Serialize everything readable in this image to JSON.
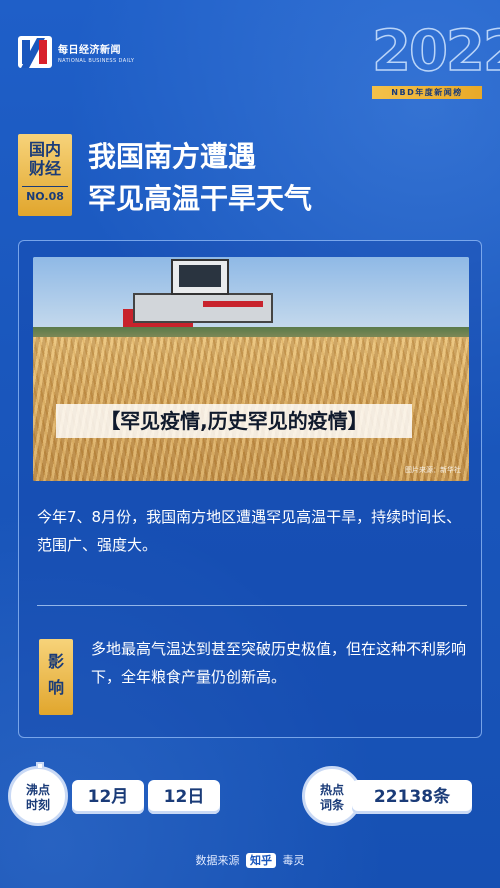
{
  "brand": {
    "name_cn": "每日经济新闻",
    "name_en": "NATIONAL BUSINESS DAILY"
  },
  "year_block": {
    "year": "2022",
    "strip": "NBD年度新闻榜"
  },
  "title_badge": {
    "line1": "国内",
    "line2": "财经",
    "number": "NO.08"
  },
  "title": {
    "line1": "我国南方遭遇",
    "line2": "罕见高温干旱天气"
  },
  "photo": {
    "caption": "【罕见疫情,历史罕见的疫情】",
    "credit": "图片来源：新华社"
  },
  "body": {
    "para1": "今年7、8月份，我国南方地区遭遇罕见高温干旱，持续时间长、范围广、强度大。",
    "impact_label_1": "影",
    "impact_label_2": "响",
    "para2": "多地最高气温达到甚至突破历史极值，但在这种不利影响下，全年粮食产量仍创新高。"
  },
  "stats": {
    "boil_label_1": "沸点",
    "boil_label_2": "时刻",
    "month": "12月",
    "day": "12日",
    "hot_label_1": "热点",
    "hot_label_2": "词条",
    "count": "22138条"
  },
  "footer": {
    "prefix": "数据来源",
    "zhihu": "知乎",
    "suffix": "毒灵"
  },
  "colors": {
    "background": "#1a57bd",
    "gold": "#e1a62d",
    "navy": "#1a3b78"
  }
}
